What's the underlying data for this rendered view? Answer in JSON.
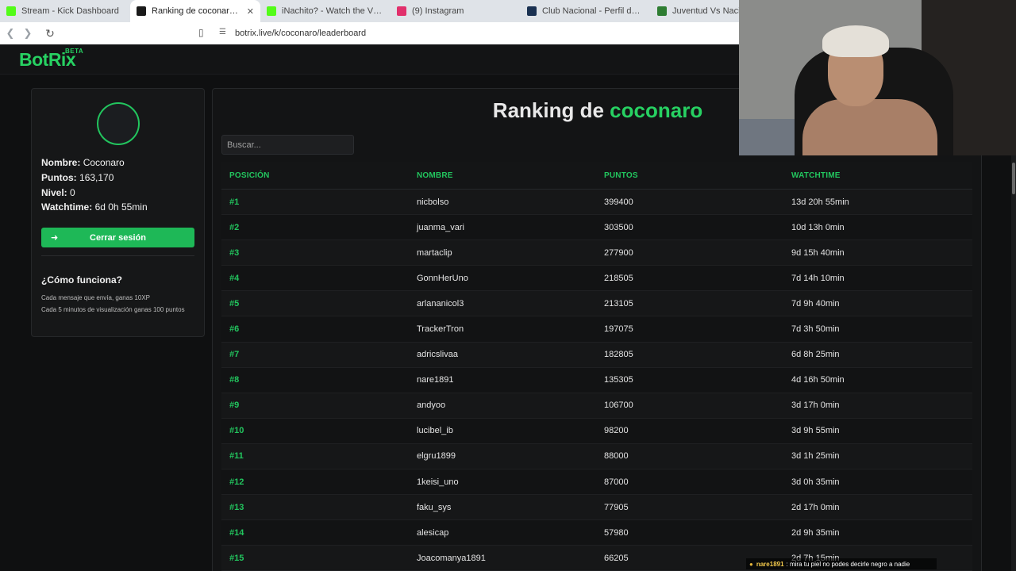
{
  "browser": {
    "tabs": [
      {
        "label": "Stream - Kick Dashboard",
        "icon": "kick-icon",
        "color": "#53fc18"
      },
      {
        "label": "Ranking de coconaro | El mejor c",
        "icon": "botrix-icon",
        "color": "#1a1a1a",
        "active": true
      },
      {
        "label": "iNachito? - Watch the VOD on Kick",
        "icon": "kick-icon",
        "color": "#53fc18"
      },
      {
        "label": "(9) Instagram",
        "icon": "instagram-icon",
        "color": "#e1306c"
      },
      {
        "label": "Club Nacional - Perfil del club | Trans",
        "icon": "transfermarkt-icon",
        "color": "#1a3151"
      },
      {
        "label": "Juventud Vs Nacional - A",
        "icon": "soccer-icon",
        "color": "#2e7d32"
      }
    ],
    "url": "botrix.live/k/coconaro/leaderboard"
  },
  "site": {
    "logo": "BotRix",
    "beta": "BETA"
  },
  "profile": {
    "name_label": "Nombre:",
    "name_value": "Coconaro",
    "points_label": "Puntos:",
    "points_value": "163,170",
    "level_label": "Nivel:",
    "level_value": "0",
    "watchtime_label": "Watchtime:",
    "watchtime_value": "6d 0h 55min",
    "logout_label": "Cerrar sesión",
    "howto_title": "¿Cómo funciona?",
    "howto_lines": [
      "Cada mensaje que envía, ganas 10XP",
      "Cada 5 minutos de visualización ganas 100 puntos"
    ]
  },
  "leaderboard": {
    "title_prefix": "Ranking de",
    "title_name": "coconaro",
    "search_placeholder": "Buscar...",
    "headers": [
      "POSICIÓN",
      "NOMBRE",
      "PUNTOS",
      "WATCHTIME"
    ],
    "rows": [
      [
        "#1",
        "nicbolso",
        "399400",
        "13d 20h 55min"
      ],
      [
        "#2",
        "juanma_vari",
        "303500",
        "10d 13h 0min"
      ],
      [
        "#3",
        "martaclip",
        "277900",
        "9d 15h 40min"
      ],
      [
        "#4",
        "GonnHerUno",
        "218505",
        "7d 14h 10min"
      ],
      [
        "#5",
        "arlananicol3",
        "213105",
        "7d 9h 40min"
      ],
      [
        "#6",
        "TrackerTron",
        "197075",
        "7d 3h 50min"
      ],
      [
        "#7",
        "adricslivaa",
        "182805",
        "6d 8h 25min"
      ],
      [
        "#8",
        "nare1891",
        "135305",
        "4d 16h 50min"
      ],
      [
        "#9",
        "andyoo",
        "106700",
        "3d 17h 0min"
      ],
      [
        "#10",
        "lucibel_ib",
        "98200",
        "3d 9h 55min"
      ],
      [
        "#11",
        "elgru1899",
        "88000",
        "3d 1h 25min"
      ],
      [
        "#12",
        "1keisi_uno",
        "87000",
        "3d 0h 35min"
      ],
      [
        "#13",
        "faku_sys",
        "77905",
        "2d 17h 0min"
      ],
      [
        "#14",
        "alesicap",
        "57980",
        "2d 9h 35min"
      ],
      [
        "#15",
        "Joacomanya1891",
        "66205",
        "2d 7h 15min"
      ]
    ]
  },
  "chat": {
    "user": "nare1891",
    "message": ": mira tu piel no podes decirle negro a nadie"
  },
  "colors": {
    "accent": "#22c55e",
    "background": "#0f1011",
    "panel": "#161718"
  }
}
